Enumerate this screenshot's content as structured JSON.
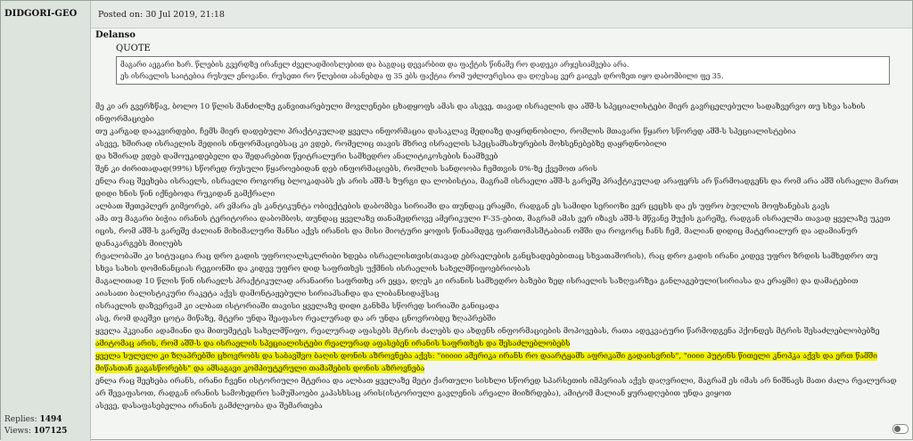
{
  "sidebar": {
    "username": "DIDGORI-GEO",
    "replies_label": "Replies:",
    "replies_value": "1494",
    "views_label": "Views:",
    "views_value": "107125"
  },
  "post": {
    "posted_prefix": "Posted on:",
    "posted_date": "30 Jul 2019, 21:18"
  },
  "quote": {
    "author": "Delanso",
    "title": "QUOTE",
    "line1": "მაგარი აეგარი ხარ. წლების გვერდზე ირანელ ძველადმიისლებით და ბაგდაც დევარბით და ფაქტის წინაშე რო დადეკი არჯესიამვება არა.",
    "line2": "ეს ისრაელის საიტებია რუსულ ენოვანი. რუსეთი რო წლებით აბანებდა ფ 35 ებს ფაქტია რომ უძლიურესია და დღესაც ვერ გაიგეს დროზეთ იყო დაბომბილი ფე 35."
  },
  "body": {
    "lines": [
      "მე კი არ გვერზწავ, ბოლო 10 წლის მანძილზე განვითარებული მოვლენები ცხადყოფს ამას და ასევე, თავად ისრაელის და აშშ-ს სპეციალისტები მიერ გავრცელებული სადაზვერვო თუ სხვა სახის",
      "ინფორმაციები",
      "თუ კარგად დააკვირდები, ჩემს მიერ დადებული პრაქტიკულად ყველა ინფორმაცია დასაკლავ მედიაზე დაყრდნობილი, რომლის მთავარი წყარო სწორედ აშშ-ს სპეციალისტებია",
      "ასევე, ხშირად ისრაელის მედიის ინფორმაციებსაც კი ვდებ, რომელიც თავის მხრივ ისრაელის სპეცსამსახურების მოხსენებებზე დაყრდნობილი",
      "და ხშირად ვდებ დამოუკიდებელი და შედარებით წეიტრალური სამხედრო ანალიტიკოსების ნაამზვებ",
      "შენ კი ძირითადად(99%) სწორედ რუსული წყაროებიდან დებ ინფორმაციებს, რომლის სანდოობა ჩემთვის 0%-ზე ქვემოთ არის",
      "ენლა რაც შეეხება ისრაელს, ისრაელი როგორც ბლოკადაბს ეს არის აშშ-ს ზურგი და ლობისტია, მაგრამ ისრაელი აშშ-ს გარეშე პრაქტიკულად არაფერს არ წარმოადგენს და რომ არა აშშ ისრაელი მართლა",
      "დიდი ხნის წინ იქნებოდა რუკიდან გამქრალი",
      "ალბათ შეთეპლერ გიმეორებ, არ ვმარა ეს კანტიკუნტა ობიექტების დაბომბვა სირიაში და თუნდაც ერაყში, რადგან ეს სამიდი სერიოზი ვერ ცეცხს და ეს უფრო ბუღლის მოფხანებას გავს",
      "ამა თუ მაგარი ბიჭია ირანის ტერიტორია დაბომბოს, თუნდაც ყველაზე თანამედროვე ამერიკული F-35-ებით, მაგრამ ამას ვერ იზავს აშშ-ს მწვანე შუქის გარეშე, რადგან ისრაელმა თავად ყველაზე უკეთ",
      "იცის, რომ აშშ-ს გარეშე ძალიან მიხიმალური შანსი აქვს ირანის და მისი მიოტური ყოფის წინაამდეგ ფართომასშტაბიან ომში და როგორც ჩანს ჩემ, მალიან დიდიც მატერიალურ და ადამიანურ",
      "დანაკარგებს მიიღებს",
      "რეალობაში კი სიტუაცია რაც დრო გადის უფროღალსკლრიბი ხდება ისრაელისთვის(თავად ებრაელების განცხადებებითაც სხვათაშორის), რაც დრო გადის ირანი კიდევ უფრო ზრდის სამხედრო თუ",
      "სხვა სახის დომინანციას რეგიონში და კიდევ უფრო დიდ საფრთხეს უქმნის ისრაელის სახელმწიფოებრიობას",
      "მაგალითად 10 წლის წინ ისრაელს პრაქტიკულად არანაირი საფრთხე არ ეყვა, დღეს კი ირანის სამხედრო ბაზები ზედ ისრაელის საზღვარზეა განლაგებული(სირიასა და ერაყში) და დამატებით",
      "აიასათი ბალისტიკური რაკეტა აქვს დამონტაჟებული სირიაჰსაჩდა და ლიბანსიდაჭსაც",
      "ისრაელის დაზვერვამ კი ალბათ ისტორიაში თავისი ყველაზე დიდი განხმა სწორედ სირიაში განიცადა",
      "ასე, რომ დაეშვი ცოტა მიწაზე, მტერი უნდა შეაფასო რეალურად და არ უნდა ცნოვრობდე ზღაპრებში",
      "ყველა ჰკვიანი ადამიანი და მითუმეტეს სახელმწიფო, რეალურად აფასებს მტრის ძალებს და ახდენს ინფორმაციების მოპოვებას, რათა ადეკვატური წარმოდგენა ჰქონდეს მტრის შესაძლებლობებზე",
      "ამიტომაც არის, რომ აშშ-ს და ისრაელის სპეციალისტები რეალურად აფასებენ ირანის საფრთხეს და შესაძლებლობებს",
      "ყველა სულელი კი ზღაპრებში ცხოვრობს და საბავშვო ბაღის დონის აზროვნება აქვს: \"იიიიი ამერიკა ირანს რო დაარტყამს აფრიკაში გადაისვრის\", \"იიიი პუტინს წითელი კნოპკა აქვს და ერთ წამში",
      "მიწასთან გაგასწორებს\" და ამსაგავი კომპიუტერული თამაშების დონის აზროვნება",
      "ენლა რაც შეეხება ირანს, ირანი ჩვენი ისტორიული მტერია და ალბათ ყველაზე მეტი ქართული სისხლი სწორედ სპარსეთის იმპერიას აქვს დაღვრილი, მაგრამ ეს იმას არ ნიშნავს მათი ძალა რეალურად",
      "არ შევაფასოთ, რადგან ირანის სამოხედრო სამუშაოები კაპასხსაც არის(ისტორიული გავლენის არეალი მიიზრდება), ამიტომ მალიან ყურადღებით უნდა ვიყოთ",
      "ასევე, დასაფასებელია ირანის გამძლეობა და შემართება"
    ]
  }
}
